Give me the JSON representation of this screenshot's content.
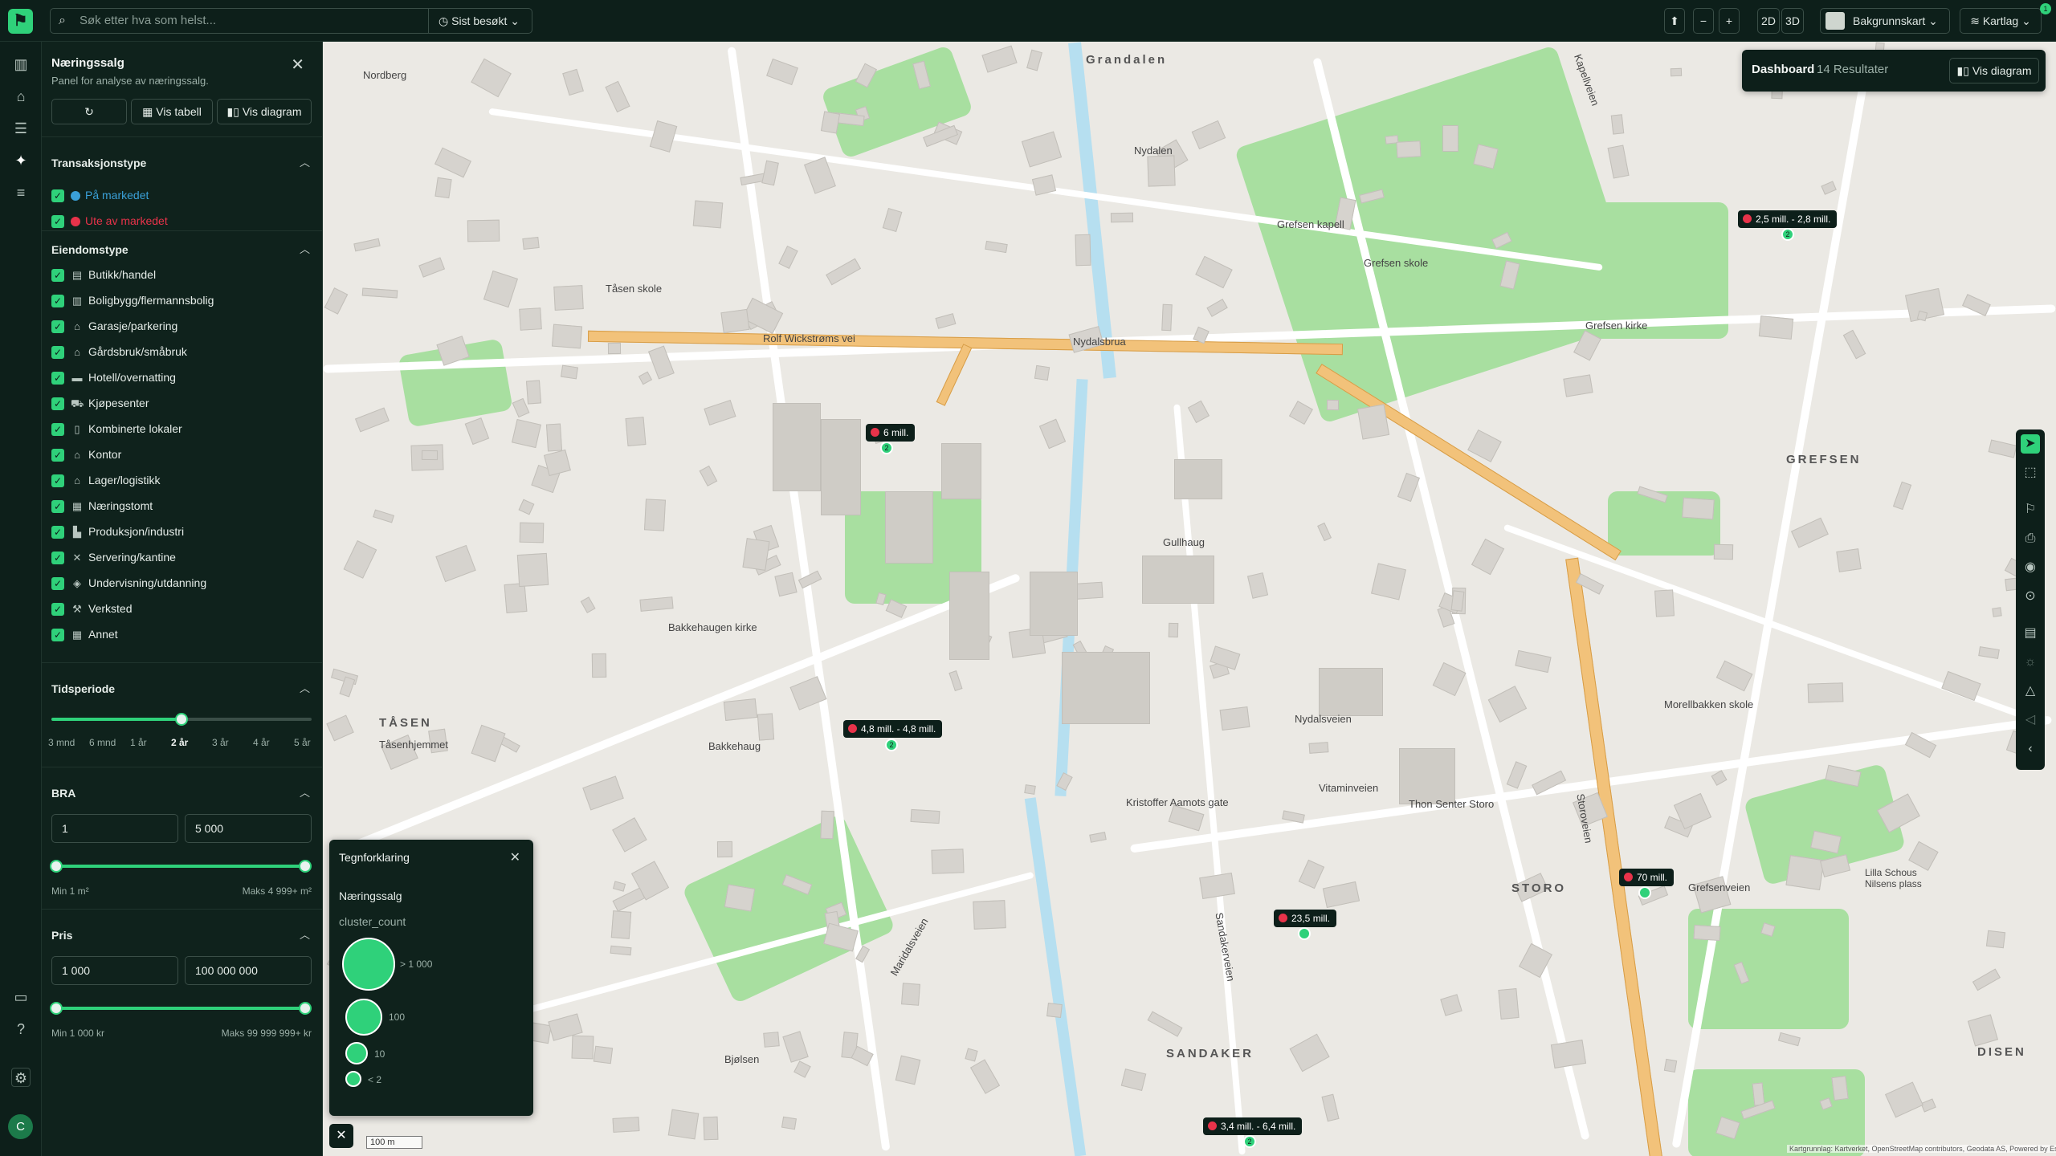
{
  "topbar": {
    "logo": "⚑",
    "search_placeholder": "Søk etter hva som helst...",
    "recent_label": "Sist besøkt",
    "view_2d": "2D",
    "view_3d": "3D",
    "zoom_out": "−",
    "zoom_in": "+",
    "basemap_label": "Bakgrunnskart",
    "layers_label": "Kartlag",
    "notification_count": "1"
  },
  "rail": {
    "avatar_initial": "C"
  },
  "panel": {
    "title": "Næringssalg",
    "subtitle": "Panel for analyse av næringssalg.",
    "table_button": "Vis tabell",
    "diagram_button": "Vis diagram",
    "transaction": {
      "heading": "Transaksjonstype",
      "items": [
        {
          "label": "På markedet",
          "color": "#3aa0d8"
        },
        {
          "label": "Ute av markedet",
          "color": "#e8334a"
        }
      ]
    },
    "property": {
      "heading": "Eiendomstype",
      "items": [
        {
          "label": "Butikk/handel",
          "icon": "shop-icon"
        },
        {
          "label": "Boligbygg/flermannsbolig",
          "icon": "apartment-icon"
        },
        {
          "label": "Garasje/parkering",
          "icon": "garage-icon"
        },
        {
          "label": "Gårdsbruk/småbruk",
          "icon": "farm-icon"
        },
        {
          "label": "Hotell/overnatting",
          "icon": "bed-icon"
        },
        {
          "label": "Kjøpesenter",
          "icon": "cart-icon"
        },
        {
          "label": "Kombinerte lokaler",
          "icon": "building-icon"
        },
        {
          "label": "Kontor",
          "icon": "office-icon"
        },
        {
          "label": "Lager/logistikk",
          "icon": "warehouse-icon"
        },
        {
          "label": "Næringstomt",
          "icon": "plot-icon"
        },
        {
          "label": "Produksjon/industri",
          "icon": "factory-icon"
        },
        {
          "label": "Servering/kantine",
          "icon": "cutlery-icon"
        },
        {
          "label": "Undervisning/utdanning",
          "icon": "school-icon"
        },
        {
          "label": "Verksted",
          "icon": "wrench-icon"
        },
        {
          "label": "Annet",
          "icon": "grid-icon"
        }
      ]
    },
    "period": {
      "heading": "Tidsperiode",
      "ticks": [
        "3 mnd",
        "6 mnd",
        "1 år",
        "2 år",
        "3 år",
        "4 år",
        "5 år"
      ],
      "selected": "2 år"
    },
    "bra": {
      "heading": "BRA",
      "min_value": "1",
      "max_value": "5 000",
      "min_hint": "Min 1 m²",
      "max_hint": "Maks 4 999+ m²"
    },
    "price": {
      "heading": "Pris",
      "min_value": "1 000",
      "max_value": "100 000 000",
      "min_hint": "Min 1 000 kr",
      "max_hint": "Maks 99 999 999+ kr"
    }
  },
  "map": {
    "dashboard_label": "Dashboard",
    "results": "14 Resultater",
    "dashboard_diagram": "Vis diagram",
    "price_tags": [
      {
        "label": "2,5 mill. - 2,8 mill.",
        "cluster": "2"
      },
      {
        "label": "6 mill.",
        "cluster": "2"
      },
      {
        "label": "4,8 mill. - 4,8 mill.",
        "cluster": "2"
      },
      {
        "label": "70 mill.",
        "cluster": ""
      },
      {
        "label": "23,5 mill.",
        "cluster": ""
      },
      {
        "label": "3,4 mill. - 6,4 mill.",
        "cluster": "2"
      }
    ],
    "places": [
      "Grandalen",
      "GREFSEN",
      "TÅSEN",
      "SANDAKER",
      "STORO",
      "DISEN"
    ],
    "labels": [
      "Nordberg",
      "Nydalen",
      "Grefsen kapell",
      "Grefsen skole",
      "Grefsen kirke",
      "Rolf Wickstrøms vei",
      "Nydalsbrua",
      "Tåsen skole",
      "Gullhaug",
      "Bakkehaugen kirke",
      "Bakkehaug",
      "Tåsenhjemmet",
      "Thon Senter Storo",
      "Morellbakken skole",
      "Lilla Schous Nilsens plass",
      "Bjølsen",
      "Nydalsveien",
      "Vitaminveien",
      "Kristoffer Aamots gate",
      "Sandakerveien",
      "Kapellveien",
      "Grefsenveien",
      "Storoveien",
      "Maridalsveien"
    ],
    "scale": "100 m",
    "attribution": "Kartgrunnlag: Kartverket, OpenStreetMap contributors, Geodata AS, Powered by Esri",
    "legend": {
      "title": "Tegnforklaring",
      "layer": "Næringssalg",
      "field": "cluster_count",
      "items": [
        "> 1 000",
        "100",
        "10",
        "< 2"
      ]
    }
  }
}
